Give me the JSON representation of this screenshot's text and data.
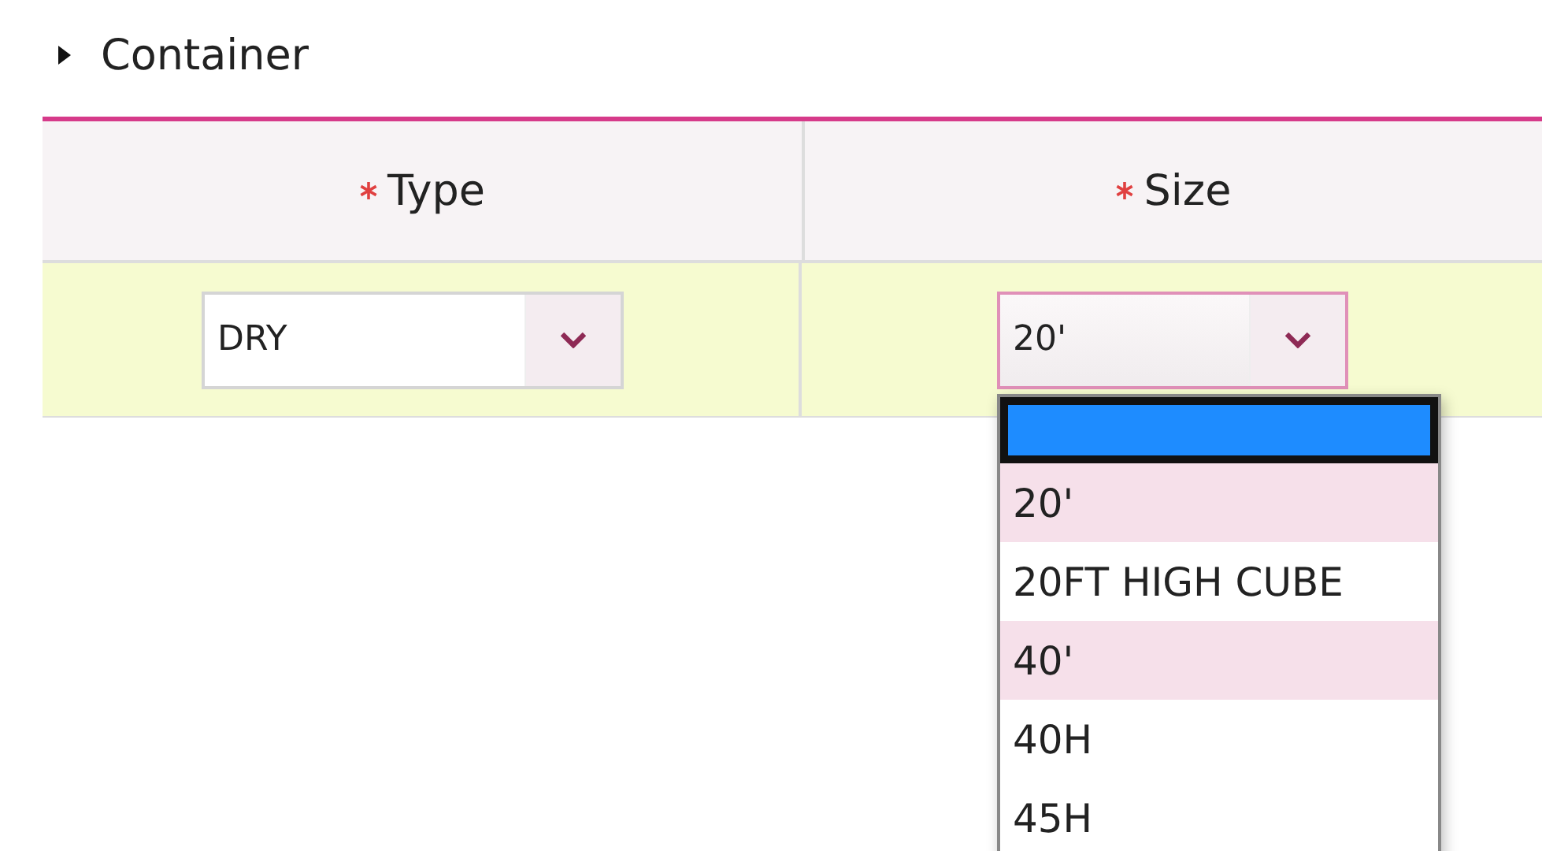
{
  "section": {
    "title": "Container",
    "expanded": false
  },
  "table": {
    "columns": [
      {
        "label": "Type",
        "required": true
      },
      {
        "label": "Size",
        "required": true
      }
    ],
    "row": [
      {
        "value": "DRY",
        "focused": false
      },
      {
        "value": "20'",
        "focused": true
      }
    ]
  },
  "dropdown": {
    "options": [
      {
        "selected": true,
        "highlighted": false
      },
      {
        "label": "20'",
        "selected": false,
        "highlighted": true
      },
      {
        "label": "20FT HIGH CUBE",
        "selected": false,
        "highlighted": false
      },
      {
        "label": "40'",
        "selected": false,
        "highlighted": true
      },
      {
        "label": "40H",
        "selected": false,
        "highlighted": false
      },
      {
        "label": "45H",
        "selected": false,
        "highlighted": false
      }
    ]
  }
}
